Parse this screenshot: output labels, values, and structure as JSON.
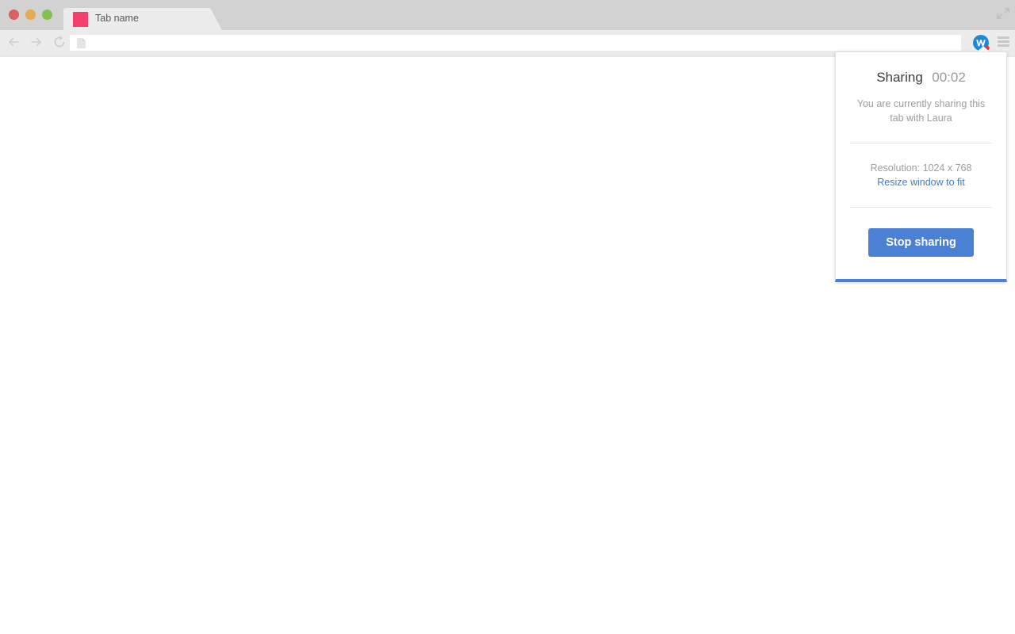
{
  "browser": {
    "window_controls": [
      {
        "name": "close",
        "color": "#d9615f"
      },
      {
        "name": "minimize",
        "color": "#e2ab56"
      },
      {
        "name": "maximize",
        "color": "#82c14f"
      }
    ],
    "resize_corner_icon": "resize-diagonal-icon",
    "tab": {
      "title": "Tab name",
      "favicon_icon": "favicon-square",
      "favicon_color": "#f43f6c"
    },
    "nav": {
      "back_icon": "back-arrow-icon",
      "forward_icon": "forward-arrow-icon",
      "reload_icon": "reload-icon"
    },
    "urlbar": {
      "value": "",
      "placeholder": "",
      "page_icon": "page-document-icon"
    },
    "extension": {
      "icon": "wisembly-w-icon",
      "letter": "w",
      "badge": "recording-dot",
      "icon_color": "#1e88d8",
      "badge_color": "#e8392f"
    },
    "menu": {
      "icon": "hamburger-menu-icon"
    }
  },
  "share_panel": {
    "title": "Sharing",
    "timer": "00:02",
    "description": "You are currently sharing this tab with Laura",
    "resolution_label": "Resolution: 1024 x 768",
    "resize_link": "Resize window to fit",
    "stop_button_label": "Stop sharing",
    "accent_color": "#4a81d4",
    "link_color": "#3f7ad1"
  }
}
